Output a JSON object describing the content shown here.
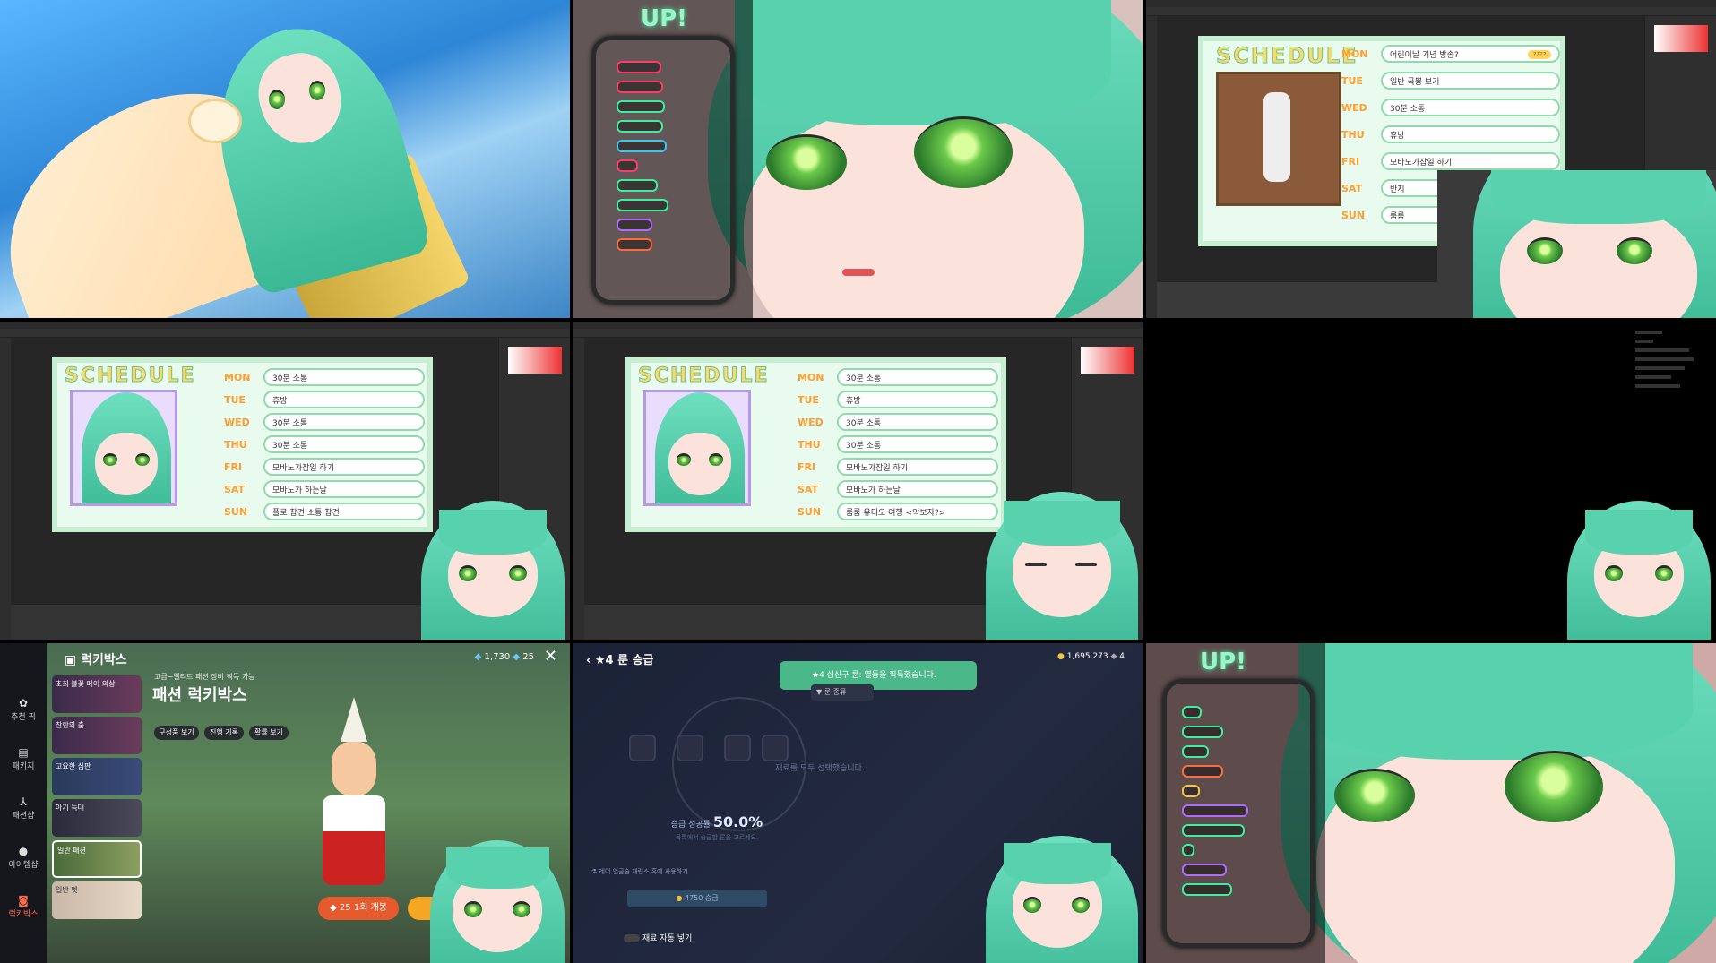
{
  "cell4": {
    "schedule_title": "SCHEDULE",
    "days": [
      {
        "day": "MON",
        "text": "30분 소통",
        "time": ""
      },
      {
        "day": "TUE",
        "text": "휴방",
        "time": ""
      },
      {
        "day": "WED",
        "text": "30분 소통",
        "time": ""
      },
      {
        "day": "THU",
        "text": "30분 소통",
        "time": ""
      },
      {
        "day": "FRI",
        "text": "모바노가잡일 하기",
        "time": ""
      },
      {
        "day": "SAT",
        "text": "모바노가 하는날",
        "time": ""
      },
      {
        "day": "SUN",
        "text": "플로 참견 소통 참견",
        "time": ""
      }
    ]
  },
  "cell5": {
    "schedule_title": "SCHEDULE",
    "days": [
      {
        "day": "MON",
        "text": "30분 소통",
        "time": ""
      },
      {
        "day": "TUE",
        "text": "휴방",
        "time": ""
      },
      {
        "day": "WED",
        "text": "30분 소통",
        "time": ""
      },
      {
        "day": "THU",
        "text": "30분 소통",
        "time": ""
      },
      {
        "day": "FRI",
        "text": "모바노가잡일 하기",
        "time": ""
      },
      {
        "day": "SAT",
        "text": "모바노가 하는날",
        "time": ""
      },
      {
        "day": "SUN",
        "text": "룸룸 유디오 여행 <악보자?>",
        "time": ""
      }
    ]
  },
  "cell3": {
    "schedule_title": "SCHEDULE",
    "days": [
      {
        "day": "MON",
        "text": "어린이날 기념 방송?",
        "time": "????"
      },
      {
        "day": "TUE",
        "text": "일반 국뽕 보기",
        "time": ""
      },
      {
        "day": "WED",
        "text": "30분 소통",
        "time": ""
      },
      {
        "day": "THU",
        "text": "휴방",
        "time": ""
      },
      {
        "day": "FRI",
        "text": "모바노가잡일 하기",
        "time": ""
      },
      {
        "day": "SAT",
        "text": "반지",
        "time": ""
      },
      {
        "day": "SUN",
        "text": "룸룸",
        "time": ""
      }
    ]
  },
  "neon": {
    "title": "UP!"
  },
  "game": {
    "header_title": "럭키박스",
    "currency_a": "1,730",
    "currency_b": "25",
    "sidebar": [
      {
        "label": "추천 픽"
      },
      {
        "label": "패키지"
      },
      {
        "label": "패션샵"
      },
      {
        "label": "아이템샵"
      },
      {
        "label": "럭키박스"
      }
    ],
    "cards": [
      {
        "label": "초희 불꽃 메이 의상"
      },
      {
        "label": "찬란의 춤"
      },
      {
        "label": "고요한 심판"
      },
      {
        "label": "아기 늑대"
      },
      {
        "label": "일반 패션"
      },
      {
        "label": "일반 펫"
      }
    ],
    "subtitle": "고급~엘리트 패션 장비 획득 가능",
    "title": "패션 럭키박스",
    "buttons": [
      "구성품 보기",
      "진행 기록",
      "확률 보기"
    ],
    "cost": "25",
    "open_label": "1회 개봉"
  },
  "upgrade": {
    "title": "★4 룬 승급",
    "currency": "1,695,273",
    "count": "4",
    "toast": "★4 심신구 룬: 열등을 획득했습니다.",
    "filter": "룬 종류",
    "rate_label": "승급 성공률",
    "rate": "50.0%",
    "rate_sub": "목록에서 승급할 룬을 고르세요.",
    "empty_text": "재료를 모두 선택했습니다.",
    "use_text": "레어 연금술 재련소 혹에 사용하기",
    "cost": "4750",
    "cost_label": "승급",
    "auto_label": "재료 자동 넣기"
  }
}
